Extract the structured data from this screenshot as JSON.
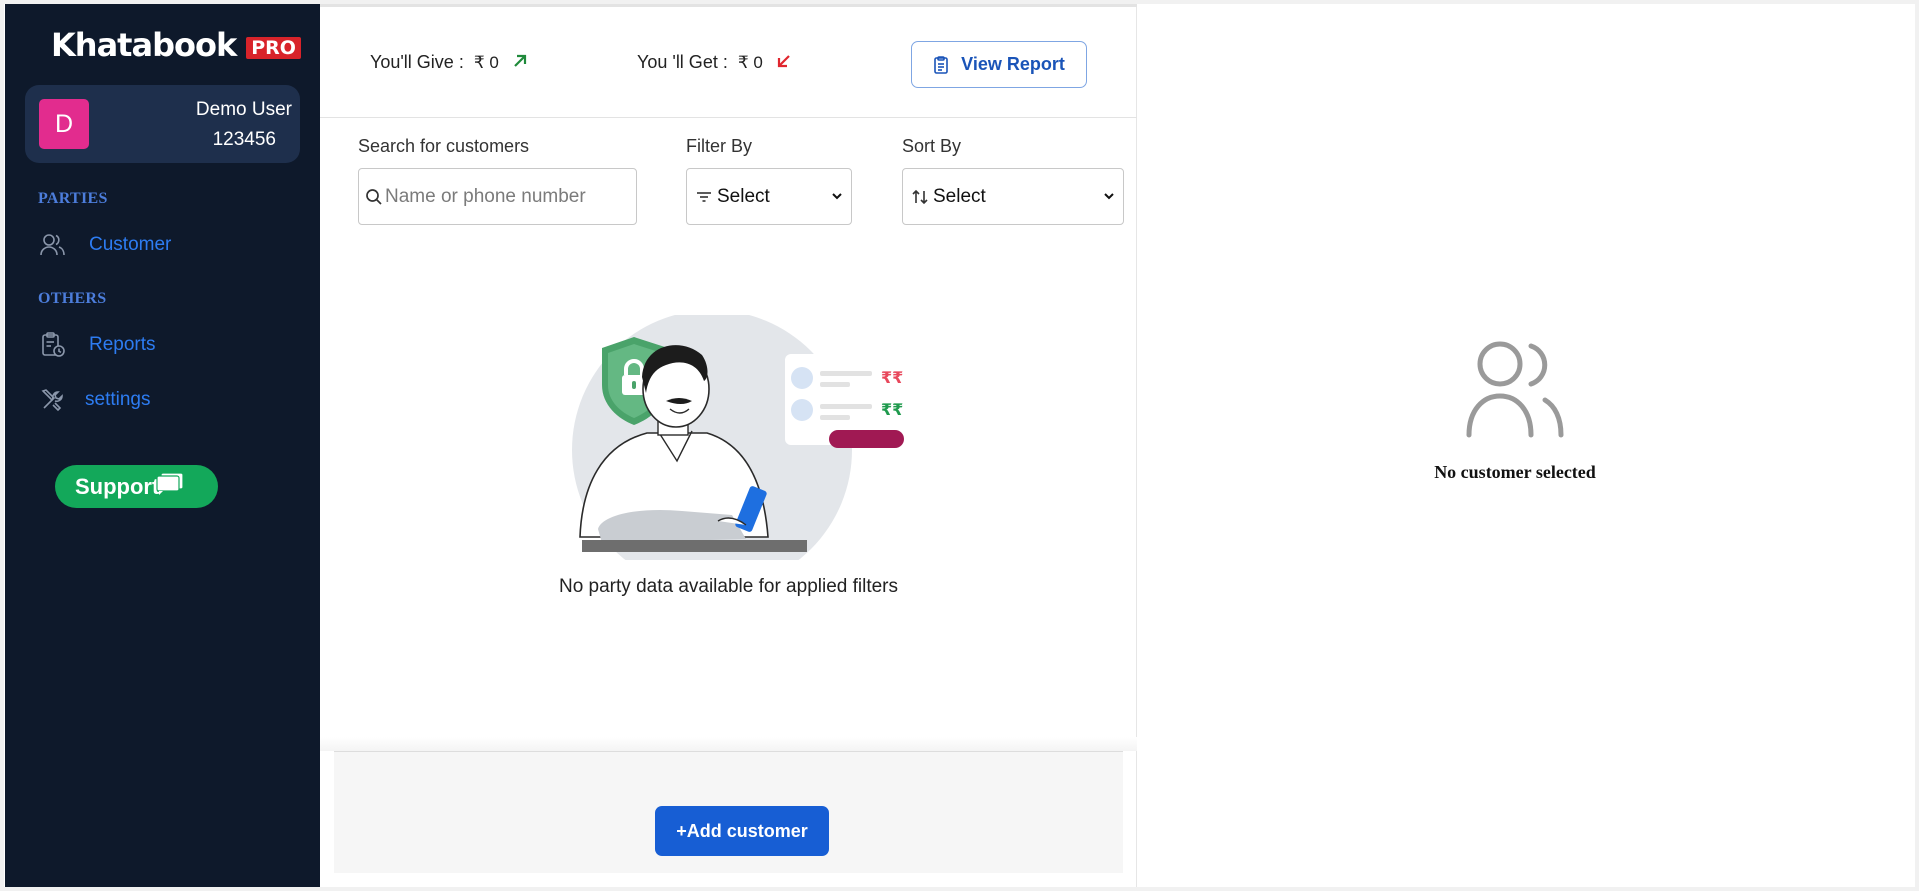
{
  "brand": {
    "name": "Khatabook",
    "badge": "PRO",
    "badge_color": "#d8232a"
  },
  "user": {
    "initial": "D",
    "name": "Demo User",
    "phone": "123456",
    "avatar_color": "#e22c8e"
  },
  "sidebar": {
    "sections": [
      {
        "label": "PARTIES",
        "items": [
          {
            "label": "Customer",
            "icon": "users-icon"
          }
        ]
      },
      {
        "label": "OTHERS",
        "items": [
          {
            "label": "Reports",
            "icon": "clipboard-clock-icon"
          },
          {
            "label": "settings",
            "icon": "tools-icon"
          }
        ]
      }
    ],
    "support": {
      "label": "Support",
      "icon": "chat-bubble-icon"
    }
  },
  "summary": {
    "give_label": "You'll Give :",
    "give_amount": "₹ 0",
    "give_arrow_color": "#1f8a3b",
    "get_label": "You 'll Get :",
    "get_amount": "₹ 0",
    "get_arrow_color": "#e0262e",
    "view_report": "View Report"
  },
  "filters": {
    "search_label": "Search for customers",
    "search_placeholder": "Name or phone number",
    "filter_label": "Filter By",
    "filter_value": "Select",
    "sort_label": "Sort By",
    "sort_value": "Select"
  },
  "empty_state": {
    "message": "No party data available for applied filters",
    "illus_rupee_red": "₹₹",
    "illus_rupee_green": "₹₹"
  },
  "footer": {
    "add_customer": "+Add customer"
  },
  "detail": {
    "empty_message": "No customer selected"
  },
  "colors": {
    "sidebar_bg": "#0e192b",
    "accent": "#175ed4",
    "support": "#13a85a",
    "nav_text": "#2d7cf2"
  }
}
